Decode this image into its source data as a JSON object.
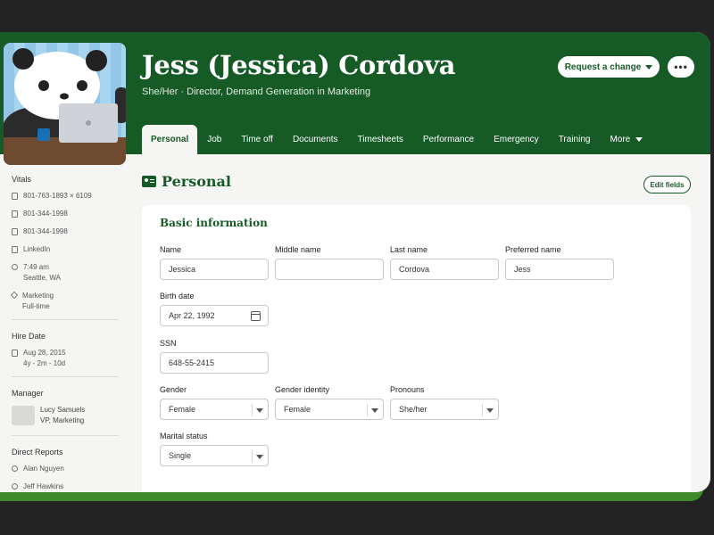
{
  "profile": {
    "name": "Jess (Jessica) Cordova",
    "subtitle": "She/Her · Director, Demand Generation in Marketing"
  },
  "header": {
    "request_label": "Request a change",
    "more_label": "•••"
  },
  "tabs": [
    {
      "label": "Personal",
      "active": true
    },
    {
      "label": "Job"
    },
    {
      "label": "Time off"
    },
    {
      "label": "Documents"
    },
    {
      "label": "Timesheets"
    },
    {
      "label": "Performance"
    },
    {
      "label": "Emergency"
    },
    {
      "label": "Training"
    },
    {
      "label": "More"
    }
  ],
  "sidebar": {
    "vitals_title": "Vitals",
    "vitals": [
      {
        "icon": "phone-icon",
        "text": "801-763-1893 × 6109"
      },
      {
        "icon": "mobile-icon",
        "text": "801-344-1998"
      },
      {
        "icon": "email-icon",
        "text": "801-344-1998"
      },
      {
        "icon": "linkedin-icon",
        "text": "LinkedIn"
      },
      {
        "icon": "clock-icon",
        "text": "7:49 am",
        "sub": "Seattle, WA"
      },
      {
        "icon": "tag-icon",
        "text": "Marketing",
        "sub": "Full-time"
      }
    ],
    "hire_title": "Hire Date",
    "hire_date": "Aug 28, 2015",
    "hire_tenure": "4y - 2m - 10d",
    "manager_title": "Manager",
    "manager_name": "Lucy Samuels",
    "manager_role": "VP, Marketing",
    "reports_title": "Direct Reports",
    "reports": [
      "Alan Nguyen",
      "Jeff Hawkins"
    ]
  },
  "main": {
    "section_title": "Personal",
    "edit_label": "Edit fields",
    "card_title": "Basic information",
    "fields": {
      "name_label": "Name",
      "name_value": "Jessica",
      "middle_label": "Middle name",
      "middle_value": "",
      "last_label": "Last name",
      "last_value": "Cordova",
      "preferred_label": "Preferred name",
      "preferred_value": "Jess",
      "birth_label": "Birth date",
      "birth_value": "Apr 22, 1992",
      "ssn_label": "SSN",
      "ssn_value": "648-55-2415",
      "gender_label": "Gender",
      "gender_value": "Female",
      "gender_identity_label": "Gender identity",
      "gender_identity_value": "Female",
      "pronouns_label": "Pronouns",
      "pronouns_value": "She/her",
      "marital_label": "Marital status",
      "marital_value": "Single"
    }
  },
  "colors": {
    "brand_green": "#165a26",
    "frame_accent": "#3f8a2a",
    "background": "#232323"
  }
}
